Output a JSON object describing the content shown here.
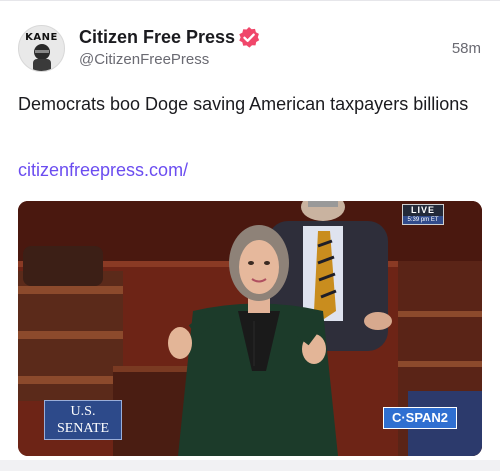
{
  "post": {
    "author_name": "Citizen Free Press",
    "handle": "@CitizenFreePress",
    "time": "58m",
    "avatar_text": "KANE",
    "text": "Democrats boo Doge saving American taxpayers billions",
    "link": "citizenfreepress.com/",
    "verified_color": "#f0476a",
    "link_color": "#6b4df0"
  },
  "media": {
    "live_label": "LIVE",
    "live_time": "5:39 pm ET",
    "senate_line1": "U.S.",
    "senate_line2": "SENATE",
    "network_logo": "C·SPAN2"
  }
}
